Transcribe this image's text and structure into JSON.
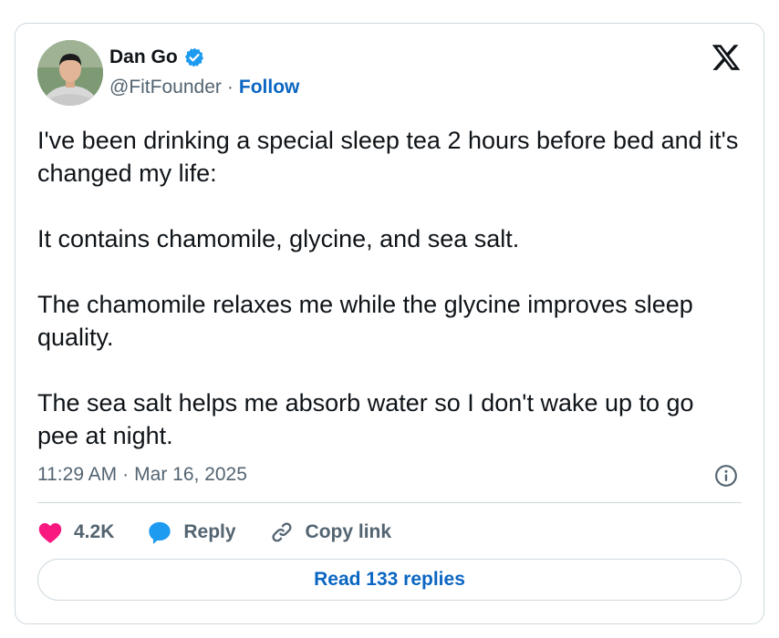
{
  "author": {
    "name": "Dan Go",
    "handle": "@FitFounder",
    "separator": "·",
    "follow_label": "Follow",
    "verified": true
  },
  "tweet": {
    "paragraphs": [
      "I've been drinking a special sleep tea 2 hours before bed and it's changed my life:",
      "It contains chamomile, glycine, and sea salt.",
      "The chamomile relaxes me while the glycine improves sleep quality.",
      "The sea salt helps me absorb water so I don't wake up to go pee at night."
    ],
    "time": "11:29 AM",
    "separator": "·",
    "date": "Mar 16, 2025"
  },
  "actions": {
    "like_count": "4.2K",
    "reply_label": "Reply",
    "copy_link_label": "Copy link",
    "read_replies_label": "Read 133 replies"
  },
  "icons": {
    "brand": "x-logo-icon",
    "verified": "verified-badge-icon",
    "info": "info-icon",
    "like": "heart-icon",
    "reply": "speech-bubble-icon",
    "copy": "link-icon"
  },
  "colors": {
    "accent": "#0a66c2",
    "verified": "#1d9bf0",
    "like": "#f91880",
    "reply": "#1d9bf0",
    "text": "#0f1419",
    "muted": "#536471",
    "border": "#cfd9de"
  }
}
